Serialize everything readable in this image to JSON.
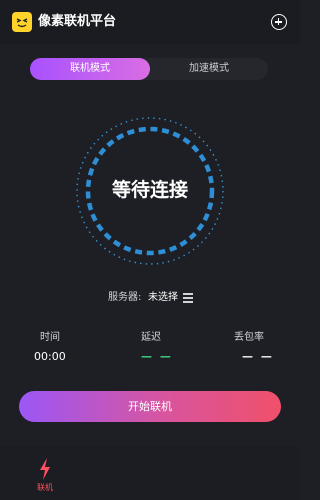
{
  "app": {
    "title": "像素联机平台",
    "logo_icon": "pixel-face-logo",
    "add_icon": "plus-circle-icon"
  },
  "tabs": [
    {
      "label": "联机模式",
      "active": true
    },
    {
      "label": "加速模式",
      "active": false
    }
  ],
  "dial": {
    "status": "等待连接",
    "ring_color": "#3aa3e8"
  },
  "server": {
    "label": "服务器:",
    "value": "未选择",
    "icon": "server-list-icon"
  },
  "stats": {
    "time_label": "时间",
    "time_value": "00:00",
    "delay_label": "延迟",
    "delay_value": "— —",
    "loss_label": "丢包率",
    "loss_value": "— —"
  },
  "actions": {
    "start_label": "开始联机"
  },
  "nav": {
    "items": [
      {
        "label": "联机",
        "icon": "lightning-icon",
        "active": true
      }
    ]
  },
  "colors": {
    "background": "#1e1f24",
    "accent_purple": "#a852ff",
    "accent_red": "#f0506a",
    "status_green": "#3ddc84",
    "logo_yellow": "#ffd32a"
  }
}
